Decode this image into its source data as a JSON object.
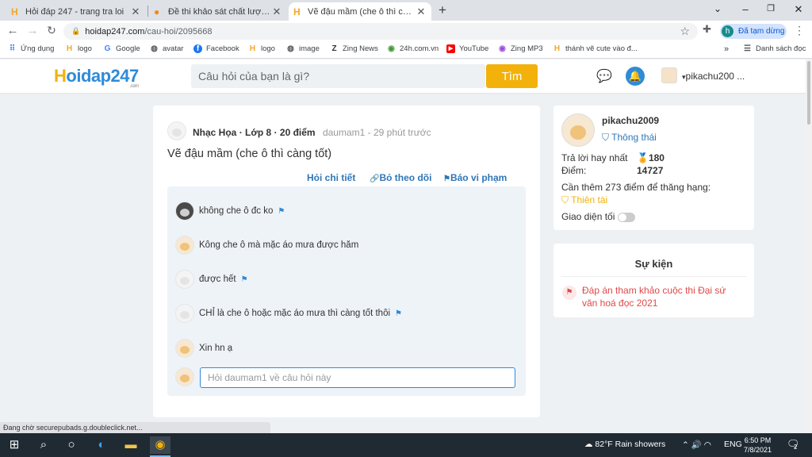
{
  "browser": {
    "tabs": [
      {
        "title": "Hỏi đáp 247 - trang tra loi",
        "active": false
      },
      {
        "title": "Đề thi khảo sát chất lượng đầu n",
        "active": false
      },
      {
        "title": "Vẽ đậu mầm (che ô thì càng tốt)",
        "active": true
      }
    ],
    "new_tab": "+",
    "url_host": "hoidap247.com",
    "url_path": "/cau-hoi/2095668",
    "profile_initial": "h",
    "profile_status": "Đã tạm dừng",
    "bookmarks": [
      {
        "label": "Ứng dụng",
        "icon": "apps-grid-icon"
      },
      {
        "label": "logo",
        "icon": "hoidap-icon"
      },
      {
        "label": "Google",
        "icon": "google-icon"
      },
      {
        "label": "avatar",
        "icon": "globe-icon"
      },
      {
        "label": "Facebook",
        "icon": "facebook-icon"
      },
      {
        "label": "logo",
        "icon": "hoidap-icon"
      },
      {
        "label": "image",
        "icon": "globe-icon"
      },
      {
        "label": "Zing News",
        "icon": "zing-icon"
      },
      {
        "label": "24h.com.vn",
        "icon": "24h-icon"
      },
      {
        "label": "YouTube",
        "icon": "youtube-icon"
      },
      {
        "label": "Zing MP3",
        "icon": "zingmp3-icon"
      },
      {
        "label": "thánh vẽ cute vào đ...",
        "icon": "hoidap-icon"
      }
    ],
    "bookmarks_more": "»",
    "reading_list": "Danh sách đọc"
  },
  "site": {
    "logo_main": "oidap247",
    "logo_h": "H",
    "logo_sub": ".com",
    "search_placeholder": "Câu hỏi của bạn là gì?",
    "search_button": "Tìm",
    "username": "pikachu200 ..."
  },
  "question": {
    "subject": "Nhạc Họa",
    "grade": "Lớp 8",
    "points": "20 điểm",
    "author": "daumam1",
    "time": "29 phút trước",
    "text": "Vẽ đậu mầm (che ô thì càng tốt)",
    "actions": [
      "Hỏi chi tiết",
      "Bỏ theo dõi",
      "Báo vi phạm"
    ],
    "comments": [
      {
        "text": "không che ô đc ko",
        "avatar": "dark",
        "flag": true
      },
      {
        "text": "Kông che ô mà mặc áo mưa được hăm",
        "avatar": "pikachu",
        "flag": false
      },
      {
        "text": "được hết",
        "avatar": "sheep",
        "flag": true
      },
      {
        "text": "CHỈ là che ô hoặc mặc áo mưa thì càng tốt thôi",
        "avatar": "sheep",
        "flag": true
      },
      {
        "text": "Xin hn ạ",
        "avatar": "pikachu",
        "flag": false
      }
    ],
    "comment_placeholder": "Hỏi daumam1 về câu hỏi này"
  },
  "profile": {
    "name": "pikachu2009",
    "status": "Thông thái",
    "best_answers_label": "Trả lời hay nhất",
    "best_answers": "180",
    "points_label": "Điểm:",
    "points": "14727",
    "next_rank": "Cần thêm 273 điểm để thăng hạng:",
    "next_rank_name": "Thiên tài",
    "dark_mode": "Giao diện tối"
  },
  "events": {
    "title": "Sự kiện",
    "items": [
      "Đáp án tham khảo cuộc thi Đại sứ văn hoá đọc 2021"
    ]
  },
  "status_tip": "Đang chờ securepubads.g.doubleclick.net...",
  "taskbar": {
    "weather": "82°F  Rain showers",
    "lang": "ENG",
    "time": "6:50 PM",
    "date": "7/8/2021",
    "notifications": "2"
  },
  "colors": {
    "brand_blue": "#2e8bd8",
    "brand_yellow": "#f2b10b",
    "event_red": "#e04848"
  }
}
